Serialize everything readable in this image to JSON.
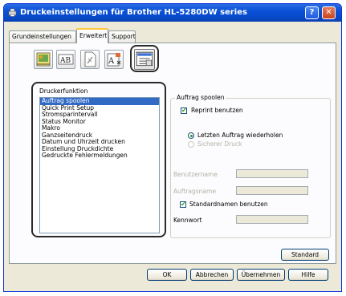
{
  "window": {
    "title": "Druckeinstellungen für Brother HL-5280DW series",
    "help_label": "?",
    "close_label": "✕"
  },
  "tabs": [
    {
      "label": "Grundeinstellungen"
    },
    {
      "label": "Erweitert"
    },
    {
      "label": "Support"
    }
  ],
  "function_panel": {
    "label": "Druckerfunktion",
    "items": [
      "Auftrag spoolen",
      "Quick Print Setup",
      "Stromsparintervall",
      "Status Monitor",
      "Makro",
      "Ganzseitendruck",
      "Datum und Uhrzeit drucken",
      "Einstellung Druckdichte",
      "Gedruckte Fehlermeldungen"
    ],
    "selected_index": 0
  },
  "spool": {
    "group_label": "Auftrag spoolen",
    "reprint_label": "Reprint benutzen",
    "last_job_label": "Letzten Auftrag wiederholen",
    "secure_print_label": "Sicherer Druck",
    "username_label": "Benutzername",
    "jobname_label": "Auftragsname",
    "standard_names_label": "Standardnamen benutzen",
    "password_label": "Kennwort"
  },
  "buttons": {
    "standard": "Standard",
    "ok": "OK",
    "cancel": "Abbrechen",
    "apply": "Übernehmen",
    "help": "Hilfe"
  }
}
